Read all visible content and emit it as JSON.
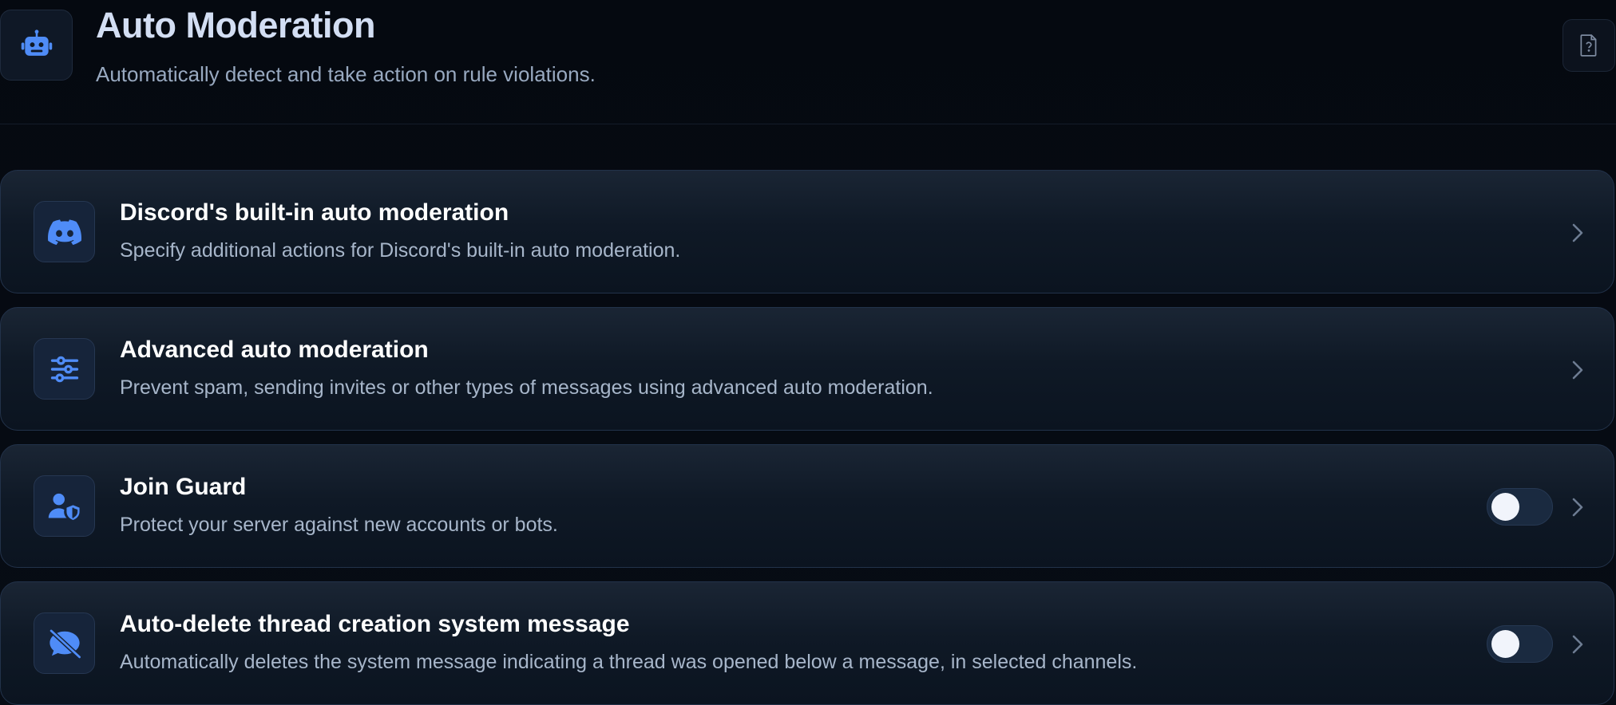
{
  "header": {
    "title": "Auto Moderation",
    "subtitle": "Automatically detect and take action on rule violations.",
    "icon": "robot-icon",
    "help_icon": "help-document-icon"
  },
  "colors": {
    "accent": "#4f8cf7",
    "card_border": "#22324a",
    "toggle_off": "#1a2a40"
  },
  "cards": [
    {
      "title": "Discord's built-in auto moderation",
      "description": "Specify additional actions for Discord's built-in auto moderation.",
      "icon": "discord-icon",
      "has_toggle": false
    },
    {
      "title": "Advanced auto moderation",
      "description": "Prevent spam, sending invites or other types of messages using advanced auto moderation.",
      "icon": "sliders-icon",
      "has_toggle": false
    },
    {
      "title": "Join Guard",
      "description": "Protect your server against new accounts or bots.",
      "icon": "user-shield-icon",
      "has_toggle": true,
      "toggle_on": false
    },
    {
      "title": "Auto-delete thread creation system message",
      "description": "Automatically deletes the system message indicating a thread was opened below a message, in selected channels.",
      "icon": "message-slash-icon",
      "has_toggle": true,
      "toggle_on": false
    }
  ]
}
